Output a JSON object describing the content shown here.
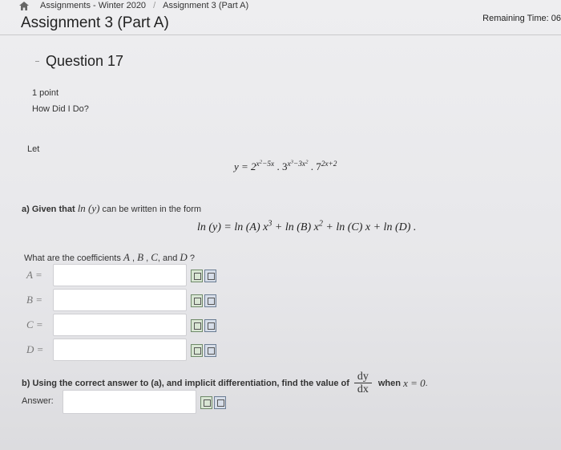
{
  "breadcrumb": {
    "home_icon": "home-icon",
    "items": [
      "Assignments - Winter 2020",
      "Assignment 3 (Part A)"
    ]
  },
  "header": {
    "title": "Assignment 3 (Part A)",
    "remaining_time": "Remaining Time: 06"
  },
  "question": {
    "heading": "Question 17",
    "points": "1 point",
    "how_did_i_do": "How Did I Do?",
    "let_label": "Let",
    "part_a_prefix": "a) Given that",
    "part_a_ln": "ln (y)",
    "part_a_suffix": "can be written in the form",
    "coef_question_prefix": "What are the coefficients",
    "coef_question_mid": ", and",
    "coef_question_suffix": "?",
    "labels": [
      "A =",
      "B =",
      "C =",
      "D ="
    ],
    "coef_letters": [
      "A",
      "B",
      "C",
      "D"
    ],
    "part_b_prefix": "b) Using the correct answer to (a), and implicit differentiation, find the value of",
    "part_b_dy": "dy",
    "part_b_dx": "dx",
    "part_b_when": "when",
    "part_b_condition": "x = 0",
    "part_b_period": ".",
    "answer_label": "Answer:"
  },
  "equation_y": {
    "lhs": "y = 2",
    "e1": "x",
    "e1_pow": "2",
    "e1_rest": "−5x",
    "dot1": " . 3",
    "e2": "x",
    "e2_pow": "3",
    "e2_mid": "−3x",
    "e2_pow2": "2",
    "dot2": " . 7",
    "e3": "2x+2"
  },
  "equation_ln": {
    "p1": "ln (y) = ln (A) x",
    "p1_pow": "3",
    "p2": " + ln (B) x",
    "p2_pow": "2",
    "p3": " + ln (C) x + ln (D)",
    "end": " ."
  }
}
